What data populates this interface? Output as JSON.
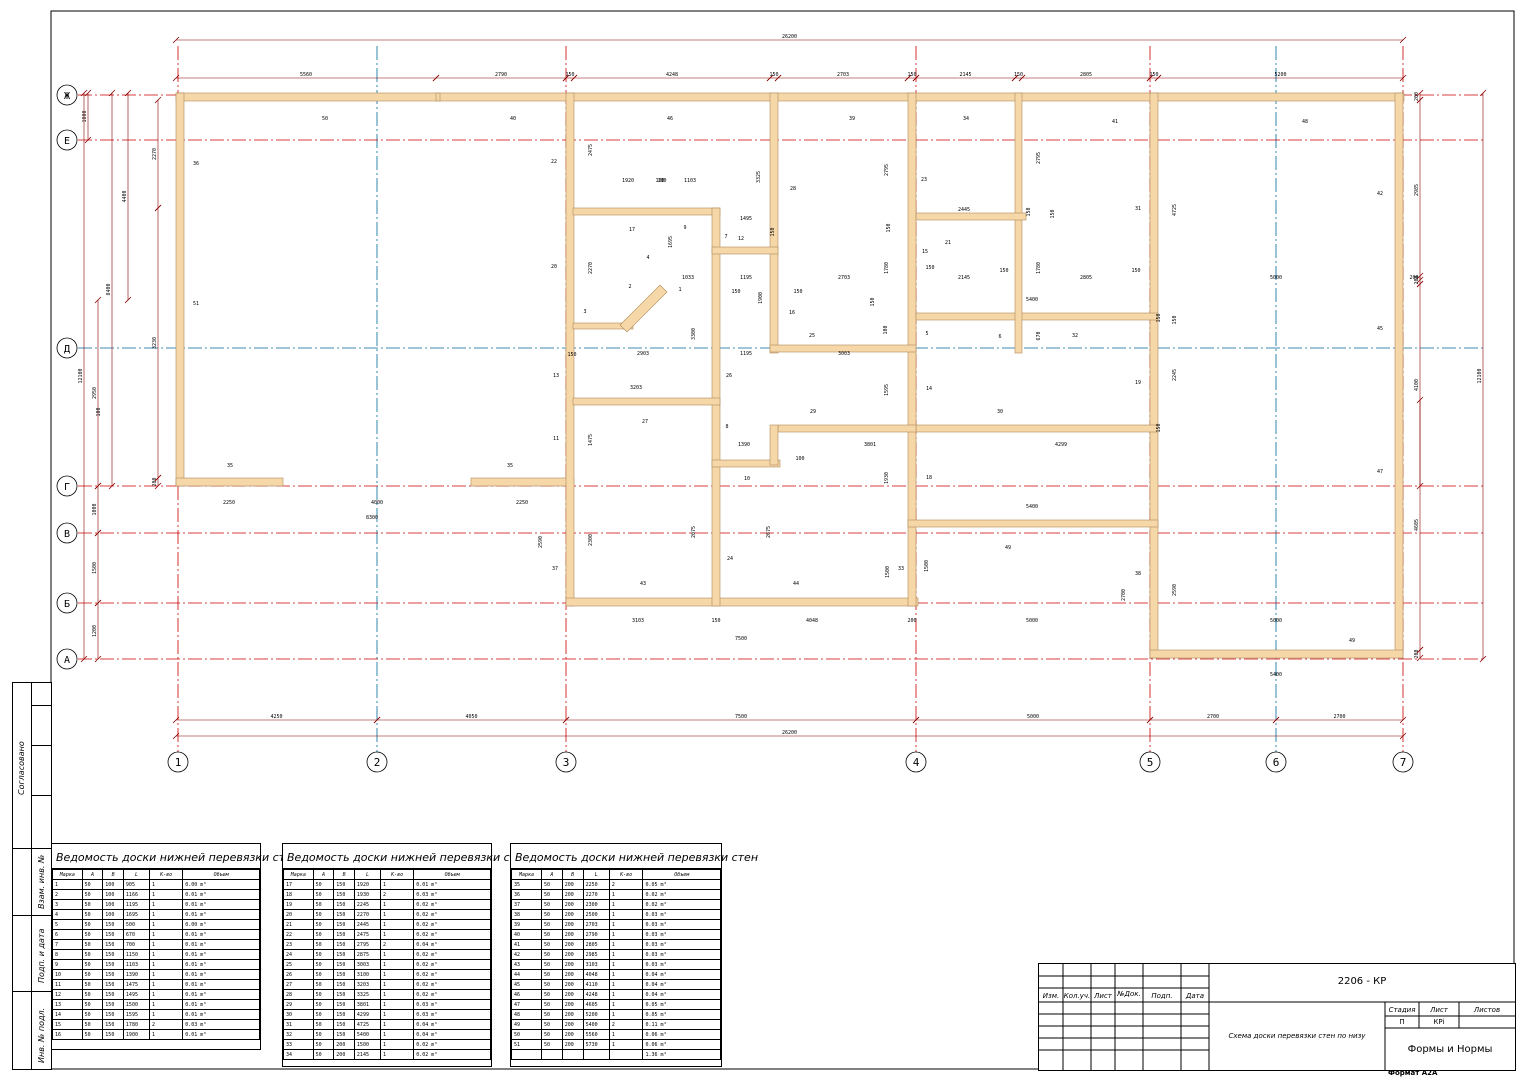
{
  "drawing": {
    "overall_dim": "26200",
    "colors": {
      "axis_red": "#cc0000",
      "axis_blue": "#006699",
      "dim": "#8b0000",
      "wall": "#f5d7a8",
      "wall_edge": "#b08b5a"
    },
    "axes_vertical": [
      {
        "id": "1"
      },
      {
        "id": "2"
      },
      {
        "id": "3"
      },
      {
        "id": "4"
      },
      {
        "id": "5"
      },
      {
        "id": "6"
      },
      {
        "id": "7"
      }
    ],
    "axes_horizontal": [
      {
        "id": "Ж"
      },
      {
        "id": "Е"
      },
      {
        "id": "Д"
      },
      {
        "id": "Г"
      },
      {
        "id": "В"
      },
      {
        "id": "Б"
      },
      {
        "id": "А"
      }
    ],
    "top_dims": [
      "5560",
      "2790",
      "150",
      "4248",
      "150",
      "2703",
      "150",
      "2145",
      "150",
      "2805",
      "150",
      "5200"
    ],
    "bottom_dims": [
      "4250",
      "4050",
      "7500",
      "5000",
      "2700",
      "2700"
    ],
    "bottom_total": "26200",
    "left_dims": [
      "1000",
      "2270",
      "4400",
      "8400",
      "3230",
      "12100",
      "2950",
      "200",
      "1000",
      "1500",
      "1200"
    ],
    "right_dims": [
      "200",
      "2985",
      "200",
      "4100",
      "12100",
      "4605",
      "200"
    ],
    "wall_marks": [
      "50",
      "40",
      "46",
      "39",
      "34",
      "41",
      "48",
      "36",
      "51",
      "22",
      "20",
      "28",
      "23",
      "31",
      "42",
      "17",
      "7",
      "12",
      "21",
      "15",
      "9",
      "4",
      "1",
      "2",
      "3",
      "16",
      "25",
      "5",
      "6",
      "32",
      "45",
      "13",
      "26",
      "14",
      "19",
      "11",
      "27",
      "8",
      "29",
      "30",
      "10",
      "18",
      "47",
      "35",
      "35",
      "37",
      "43",
      "24",
      "44",
      "33",
      "49",
      "38",
      "49"
    ],
    "inner_dims": [
      "2475",
      "1920",
      "100",
      "1103",
      "1495",
      "2445",
      "150",
      "2145",
      "150",
      "2805",
      "150",
      "5000",
      "200",
      "2270",
      "1695",
      "3325",
      "2795",
      "2795",
      "4725",
      "1033",
      "1195",
      "2703",
      "1780",
      "1780",
      "5400",
      "1900",
      "150",
      "150",
      "670",
      "150",
      "2903",
      "1195",
      "3003",
      "2245",
      "3203",
      "1475",
      "3300",
      "1390",
      "3801",
      "4299",
      "1930",
      "1595",
      "2300",
      "2075",
      "2675",
      "1500",
      "5400",
      "2250",
      "4000",
      "2250",
      "8300",
      "2590",
      "2700",
      "2590",
      "3103",
      "150",
      "4048",
      "200",
      "5000",
      "5000",
      "7500",
      "5400",
      "1500",
      "150",
      "100",
      "100",
      "100",
      "100",
      "150",
      "150",
      "150",
      "150",
      "150",
      "150",
      "150"
    ]
  },
  "side_stamp": {
    "agreed": "Согласовано",
    "inv_replace": "Взам. инв. №",
    "sign_date": "Подп. и дата",
    "inv_orig": "Инв. № подл."
  },
  "tables": [
    {
      "title": "Ведомость доски нижней перевязки стен",
      "headers": [
        "Марка",
        "A",
        "B",
        "L",
        "К-во",
        "Объем"
      ],
      "rows": [
        [
          "1",
          "50",
          "100",
          "905",
          "1",
          "0.00 m³"
        ],
        [
          "2",
          "50",
          "100",
          "1166",
          "1",
          "0.01 m³"
        ],
        [
          "3",
          "50",
          "100",
          "1195",
          "1",
          "0.01 m³"
        ],
        [
          "4",
          "50",
          "100",
          "1695",
          "1",
          "0.01 m³"
        ],
        [
          "5",
          "50",
          "150",
          "500",
          "1",
          "0.00 m³"
        ],
        [
          "6",
          "50",
          "150",
          "670",
          "1",
          "0.01 m³"
        ],
        [
          "7",
          "50",
          "150",
          "700",
          "1",
          "0.01 m³"
        ],
        [
          "8",
          "50",
          "150",
          "1150",
          "1",
          "0.01 m³"
        ],
        [
          "9",
          "50",
          "150",
          "1103",
          "1",
          "0.01 m³"
        ],
        [
          "10",
          "50",
          "150",
          "1390",
          "1",
          "0.01 m³"
        ],
        [
          "11",
          "50",
          "150",
          "1475",
          "1",
          "0.01 m³"
        ],
        [
          "12",
          "50",
          "150",
          "1495",
          "1",
          "0.01 m³"
        ],
        [
          "13",
          "50",
          "150",
          "1500",
          "1",
          "0.01 m³"
        ],
        [
          "14",
          "50",
          "150",
          "1595",
          "1",
          "0.01 m³"
        ],
        [
          "15",
          "50",
          "150",
          "1780",
          "2",
          "0.03 m³"
        ],
        [
          "16",
          "50",
          "150",
          "1900",
          "1",
          "0.01 m³"
        ]
      ]
    },
    {
      "title": "Ведомость доски нижней перевязки стен",
      "headers": [
        "Марка",
        "A",
        "B",
        "L",
        "К-во",
        "Объем"
      ],
      "rows": [
        [
          "17",
          "50",
          "150",
          "1920",
          "1",
          "0.01 m³"
        ],
        [
          "18",
          "50",
          "150",
          "1930",
          "2",
          "0.03 m³"
        ],
        [
          "19",
          "50",
          "150",
          "2245",
          "1",
          "0.02 m³"
        ],
        [
          "20",
          "50",
          "150",
          "2270",
          "1",
          "0.02 m³"
        ],
        [
          "21",
          "50",
          "150",
          "2445",
          "1",
          "0.02 m³"
        ],
        [
          "22",
          "50",
          "150",
          "2475",
          "1",
          "0.02 m³"
        ],
        [
          "23",
          "50",
          "150",
          "2795",
          "2",
          "0.04 m³"
        ],
        [
          "24",
          "50",
          "150",
          "2875",
          "1",
          "0.02 m³"
        ],
        [
          "25",
          "50",
          "150",
          "3003",
          "1",
          "0.02 m³"
        ],
        [
          "26",
          "50",
          "150",
          "3100",
          "1",
          "0.02 m³"
        ],
        [
          "27",
          "50",
          "150",
          "3203",
          "1",
          "0.02 m³"
        ],
        [
          "28",
          "50",
          "150",
          "3325",
          "1",
          "0.02 m³"
        ],
        [
          "29",
          "50",
          "150",
          "3801",
          "1",
          "0.03 m³"
        ],
        [
          "30",
          "50",
          "150",
          "4299",
          "1",
          "0.03 m³"
        ],
        [
          "31",
          "50",
          "150",
          "4725",
          "1",
          "0.04 m³"
        ],
        [
          "32",
          "50",
          "150",
          "5400",
          "1",
          "0.04 m³"
        ],
        [
          "33",
          "50",
          "200",
          "1500",
          "1",
          "0.02 m³"
        ],
        [
          "34",
          "50",
          "200",
          "2145",
          "1",
          "0.02 m³"
        ]
      ]
    },
    {
      "title": "Ведомость доски нижней перевязки стен",
      "headers": [
        "Марка",
        "A",
        "B",
        "L",
        "К-во",
        "Объем"
      ],
      "rows": [
        [
          "35",
          "50",
          "200",
          "2250",
          "2",
          "0.05 m³"
        ],
        [
          "36",
          "50",
          "200",
          "2270",
          "1",
          "0.02 m³"
        ],
        [
          "37",
          "50",
          "200",
          "2300",
          "1",
          "0.02 m³"
        ],
        [
          "38",
          "50",
          "200",
          "2500",
          "1",
          "0.03 m³"
        ],
        [
          "39",
          "50",
          "200",
          "2703",
          "1",
          "0.03 m³"
        ],
        [
          "40",
          "50",
          "200",
          "2790",
          "1",
          "0.03 m³"
        ],
        [
          "41",
          "50",
          "200",
          "2805",
          "1",
          "0.03 m³"
        ],
        [
          "42",
          "50",
          "200",
          "2985",
          "1",
          "0.03 m³"
        ],
        [
          "43",
          "50",
          "200",
          "3103",
          "1",
          "0.03 m³"
        ],
        [
          "44",
          "50",
          "200",
          "4048",
          "1",
          "0.04 m³"
        ],
        [
          "45",
          "50",
          "200",
          "4110",
          "1",
          "0.04 m³"
        ],
        [
          "46",
          "50",
          "200",
          "4248",
          "1",
          "0.04 m³"
        ],
        [
          "47",
          "50",
          "200",
          "4605",
          "1",
          "0.05 m³"
        ],
        [
          "48",
          "50",
          "200",
          "5200",
          "1",
          "0.05 m³"
        ],
        [
          "49",
          "50",
          "200",
          "5400",
          "2",
          "0.11 m³"
        ],
        [
          "50",
          "50",
          "200",
          "5560",
          "1",
          "0.06 m³"
        ],
        [
          "51",
          "50",
          "200",
          "5730",
          "1",
          "0.06 m³"
        ],
        [
          "",
          "",
          "",
          "",
          "",
          "1.36 m³"
        ]
      ]
    }
  ],
  "title_block": {
    "code": "2206 - КР",
    "cols": [
      "Изм.",
      "Кол.уч.",
      "Лист",
      "№Док.",
      "Подп.",
      "Дата"
    ],
    "stage_label": "Стадия",
    "sheet_label": "Лист",
    "sheets_label": "Листов",
    "stage": "П",
    "sheet": "КРi",
    "sheets": "",
    "subject": "Схема доски перевязки стен по низу",
    "org": "Формы и Нормы",
    "format": "Формат А2А"
  }
}
